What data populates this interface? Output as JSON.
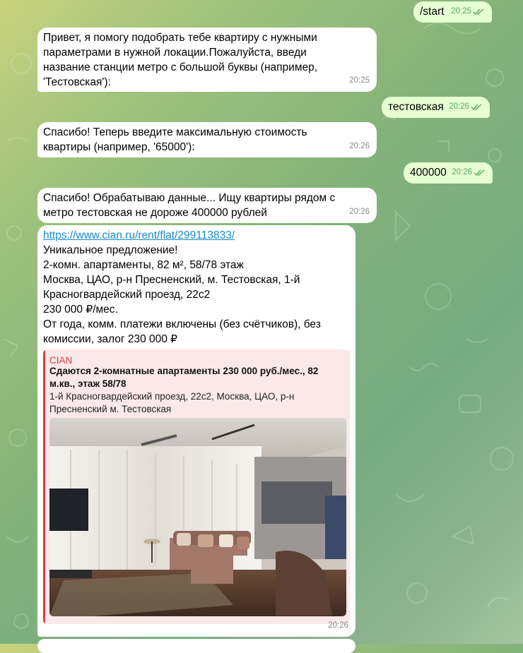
{
  "messages": [
    {
      "text": "/start",
      "time": "20:25"
    },
    {
      "text": "Привет, я помогу подобрать тебе квартиру с нужными\nпараметрами в нужной локации.Пожалуйста, введи\nназвание станции метро с большой буквы (например,\n'Тестовская'):",
      "time": "20:25"
    },
    {
      "text": "тестовская",
      "time": "20:26"
    },
    {
      "text": "Спасибо! Теперь введите максимальную стоимость\nквартиры (например, '65000'):",
      "time": "20:26"
    },
    {
      "text": "400000",
      "time": "20:26"
    },
    {
      "text": "Спасибо! Обрабатываю данные... Ищу квартиры рядом с\nметро тестовская не дороже 400000 рублей",
      "time": "20:26"
    }
  ],
  "listing": {
    "link": "https://www.cian.ru/rent/flat/299113833/",
    "body": "Уникальное предложение!\n2-комн. апартаменты, 82 м², 58/78 этаж\nМосква, ЦАО, р-н Пресненский, м. Тестовская, 1-й\nКрасногвардейский проезд, 22с2\n230 000 ₽/мес.\nОт года, комм. платежи включены (без счётчиков), без\nкомиссии, залог 230 000 ₽",
    "time": "20:26",
    "preview": {
      "site": "CIAN",
      "title": "Сдаются 2-комнатные апартаменты 230 000 руб./мес., 82\nм.кв., этаж 58/78",
      "description": "1-й Красногвардейский проезд, 22с2, Москва, ЦАО, р-н\nПресненский м. Тестовская"
    }
  },
  "colors": {
    "incoming_bubble": "#ffffff",
    "outgoing_bubble": "#e6ffd3",
    "link": "#168acd",
    "preview_accent": "#d93d3d",
    "preview_bg": "#fbe9e9",
    "read_checks": "#56a85a"
  },
  "icons": {
    "read_status": "double-check-icon"
  }
}
